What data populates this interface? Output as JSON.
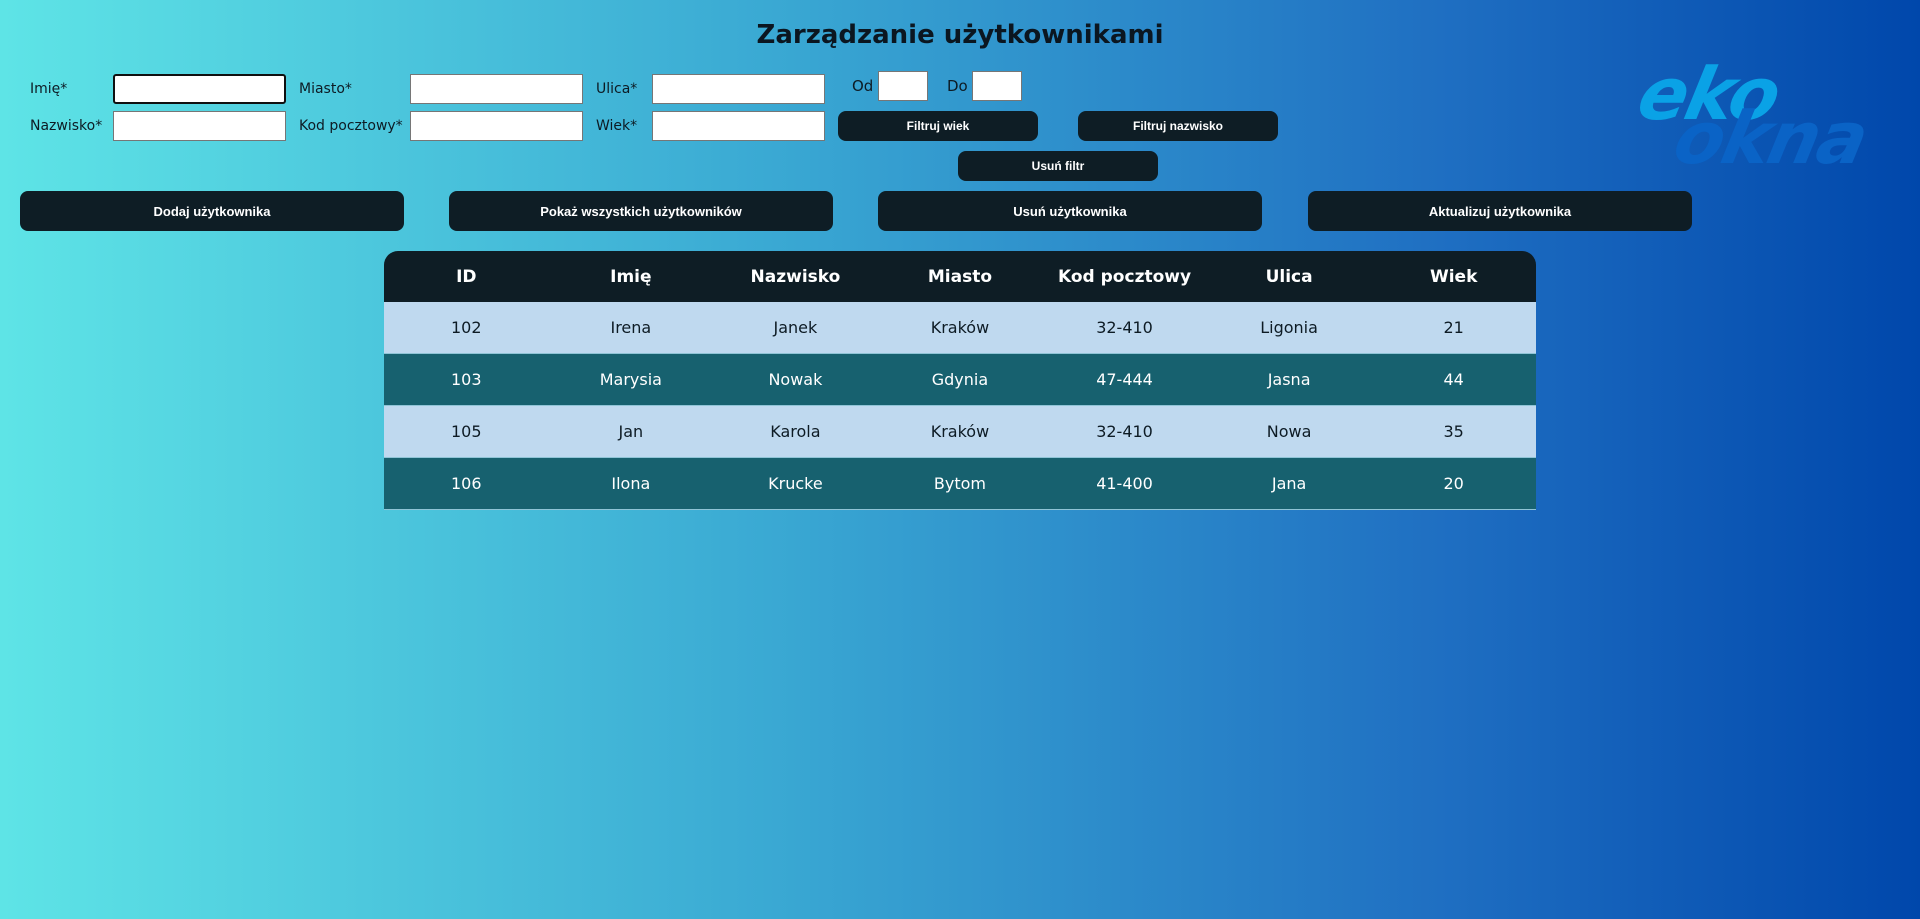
{
  "page": {
    "title": "Zarządzanie użytkownikami"
  },
  "form": {
    "imie_label": "Imię*",
    "nazwisko_label": "Nazwisko*",
    "miasto_label": "Miasto*",
    "kod_label": "Kod pocztowy*",
    "ulica_label": "Ulica*",
    "wiek_label": "Wiek*",
    "od_label": "Od",
    "do_label": "Do",
    "imie_value": "",
    "nazwisko_value": "",
    "miasto_value": "",
    "kod_value": "",
    "ulica_value": "",
    "wiek_value": "",
    "od_value": "",
    "do_value": ""
  },
  "filters": {
    "filter_age": "Filtruj wiek",
    "filter_surname": "Filtruj nazwisko",
    "remove_filter": "Usuń filtr"
  },
  "actions": {
    "add_user": "Dodaj użytkownika",
    "show_all": "Pokaż wszystkich użytkowników",
    "delete_user": "Usuń użytkownika",
    "update_user": "Aktualizuj użytkownika"
  },
  "logo": {
    "line1": "eko",
    "line2": "okna"
  },
  "colors": {
    "button_bg": "#0e1d25",
    "row_light": "#bfd9ef",
    "row_dark": "#17616f",
    "logo_top": "#0aa2e6",
    "logo_bottom": "#0a63c6"
  },
  "table": {
    "headers": [
      "ID",
      "Imię",
      "Nazwisko",
      "Miasto",
      "Kod pocztowy",
      "Ulica",
      "Wiek"
    ],
    "rows": [
      [
        "102",
        "Irena",
        "Janek",
        "Kraków",
        "32-410",
        "Ligonia",
        "21"
      ],
      [
        "103",
        "Marysia",
        "Nowak",
        "Gdynia",
        "47-444",
        "Jasna",
        "44"
      ],
      [
        "105",
        "Jan",
        "Karola",
        "Kraków",
        "32-410",
        "Nowa",
        "35"
      ],
      [
        "106",
        "Ilona",
        "Krucke",
        "Bytom",
        "41-400",
        "Jana",
        "20"
      ]
    ]
  }
}
